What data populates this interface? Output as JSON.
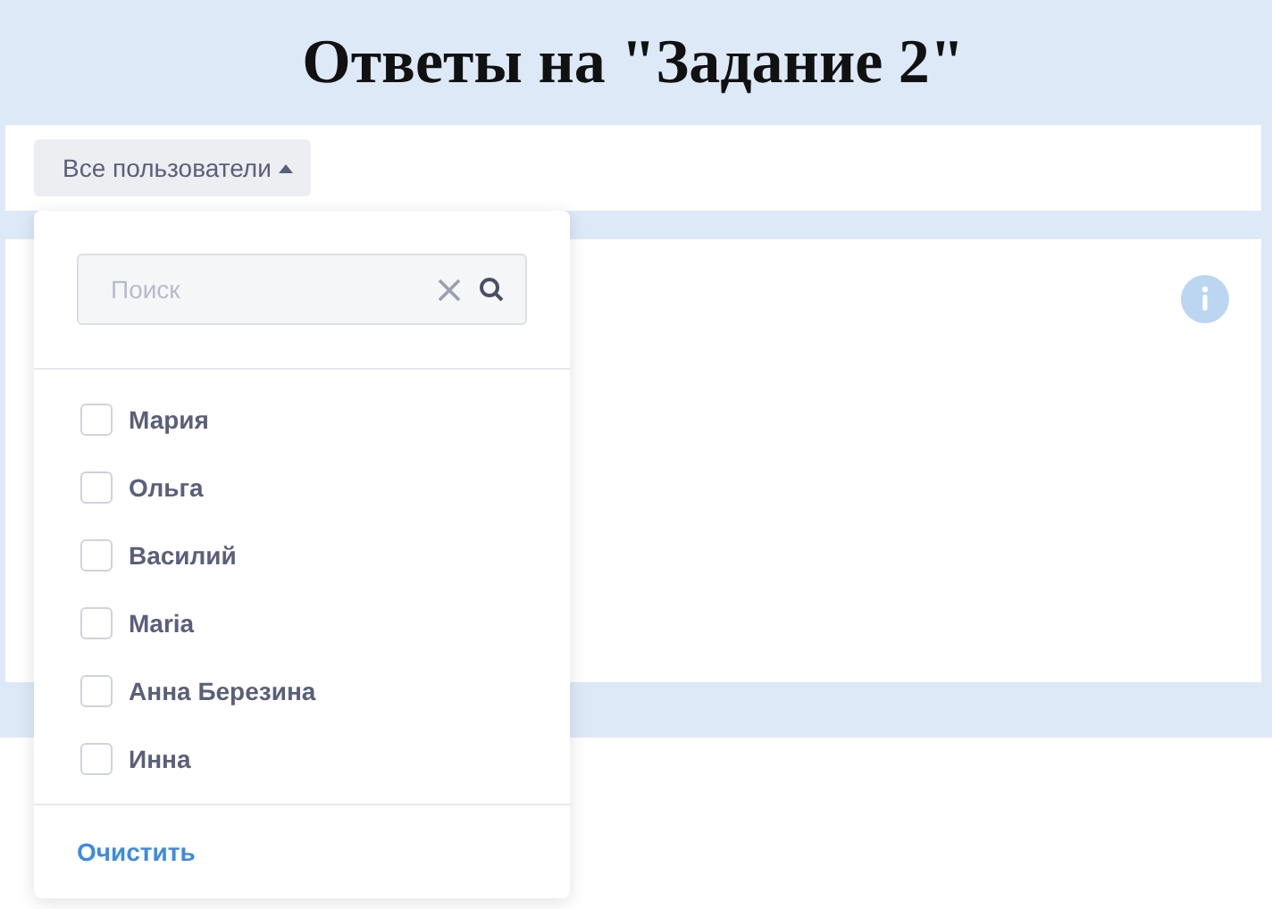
{
  "title": "Ответы на \"Задание 2\"",
  "filter_button": {
    "label": "Все пользователи",
    "expanded": true
  },
  "dropdown": {
    "search": {
      "placeholder": "Поиск"
    },
    "users": [
      {
        "name": "Мария",
        "checked": false
      },
      {
        "name": "Ольга",
        "checked": false
      },
      {
        "name": "Василий",
        "checked": false
      },
      {
        "name": "Maria",
        "checked": false
      },
      {
        "name": "Анна Березина",
        "checked": false
      },
      {
        "name": "Инна",
        "checked": false
      }
    ],
    "clear_link": "Очистить"
  }
}
